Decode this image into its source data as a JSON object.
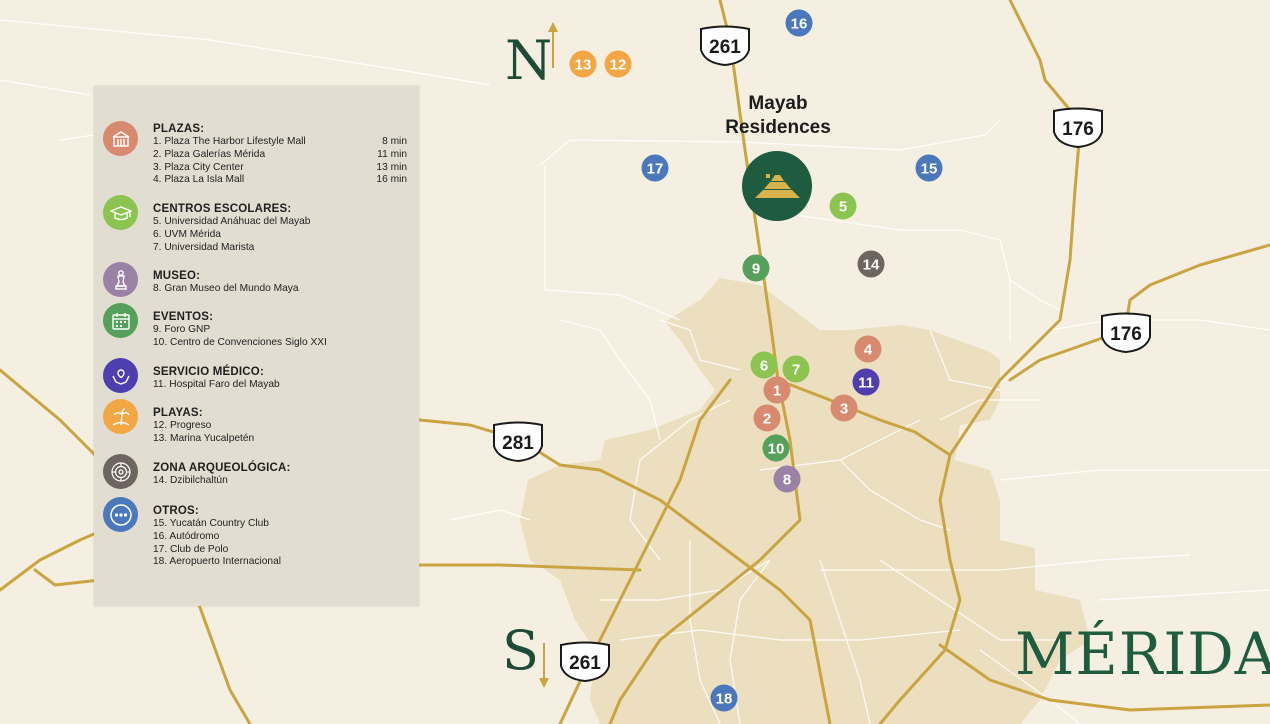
{
  "colors": {
    "background": "#f4efe1",
    "city_area": "#ecdfbf",
    "road": "#c9a441",
    "plazas": "#d88a70",
    "escolares": "#8cc450",
    "museo": "#9a82a6",
    "eventos": "#55a05b",
    "medico": "#4f3eb0",
    "playas": "#f2a644",
    "arqueologica": "#6e6460",
    "otros": "#4b78bd",
    "brand_green": "#1e5b3f"
  },
  "compass": {
    "north": "N",
    "south": "S"
  },
  "title": {
    "mayab_line1": "Mayab",
    "mayab_line2": "Residences",
    "city": "MÉRIDA"
  },
  "highways": [
    "261",
    "176",
    "176",
    "281",
    "261"
  ],
  "legend": {
    "categories": [
      {
        "key": "plazas",
        "title": "PLAZAS:",
        "icon": "mall-icon",
        "items": [
          {
            "label": "1. Plaza The Harbor Lifestyle Mall",
            "time": "8 min"
          },
          {
            "label": "2. Plaza Galerías Mérida",
            "time": "11 min"
          },
          {
            "label": "3. Plaza City Center",
            "time": "13 min"
          },
          {
            "label": "4. Plaza La Isla Mall",
            "time": "16 min"
          }
        ]
      },
      {
        "key": "escolares",
        "title": "CENTROS ESCOLARES:",
        "icon": "graduation-cap-icon",
        "items": [
          {
            "label": "5. Universidad Anáhuac del Mayab",
            "time": ""
          },
          {
            "label": "6. UVM Mérida",
            "time": ""
          },
          {
            "label": "7. Universidad Marista",
            "time": ""
          }
        ]
      },
      {
        "key": "museo",
        "title": "MUSEO:",
        "icon": "statue-icon",
        "items": [
          {
            "label": "8. Gran Museo del Mundo Maya",
            "time": ""
          }
        ]
      },
      {
        "key": "eventos",
        "title": "EVENTOS:",
        "icon": "calendar-icon",
        "items": [
          {
            "label": "9. Foro GNP",
            "time": ""
          },
          {
            "label": "10. Centro de Convenciones Siglo XXI",
            "time": ""
          }
        ]
      },
      {
        "key": "medico",
        "title": "SERVICIO MÉDICO:",
        "icon": "medical-hands-icon",
        "items": [
          {
            "label": "11. Hospital Faro del Mayab",
            "time": ""
          }
        ]
      },
      {
        "key": "playas",
        "title": "PLAYAS:",
        "icon": "beach-icon",
        "items": [
          {
            "label": "12. Progreso",
            "time": ""
          },
          {
            "label": "13. Marina Yucalpetén",
            "time": ""
          }
        ]
      },
      {
        "key": "arqueologica",
        "title": "ZONA ARQUEOLÓGICA:",
        "icon": "mayan-calendar-icon",
        "items": [
          {
            "label": "14. Dzibilchaltún",
            "time": ""
          }
        ]
      },
      {
        "key": "otros",
        "title": "OTROS:",
        "icon": "more-icon",
        "items": [
          {
            "label": "15. Yucatán Country Club",
            "time": ""
          },
          {
            "label": "16. Autódromo",
            "time": ""
          },
          {
            "label": "17. Club de Polo",
            "time": ""
          },
          {
            "label": "18. Aeropuerto Internacional",
            "time": ""
          }
        ]
      }
    ]
  },
  "markers": [
    {
      "label": "1",
      "cat": "plazas"
    },
    {
      "label": "2",
      "cat": "plazas"
    },
    {
      "label": "3",
      "cat": "plazas"
    },
    {
      "label": "4",
      "cat": "plazas"
    },
    {
      "label": "5",
      "cat": "escolares"
    },
    {
      "label": "6",
      "cat": "escolares"
    },
    {
      "label": "7",
      "cat": "escolares"
    },
    {
      "label": "8",
      "cat": "museo"
    },
    {
      "label": "9",
      "cat": "eventos"
    },
    {
      "label": "10",
      "cat": "eventos"
    },
    {
      "label": "11",
      "cat": "medico"
    },
    {
      "label": "12",
      "cat": "playas"
    },
    {
      "label": "13",
      "cat": "playas"
    },
    {
      "label": "14",
      "cat": "arqueologica"
    },
    {
      "label": "15",
      "cat": "otros"
    },
    {
      "label": "16",
      "cat": "otros"
    },
    {
      "label": "17",
      "cat": "otros"
    },
    {
      "label": "18",
      "cat": "otros"
    }
  ]
}
